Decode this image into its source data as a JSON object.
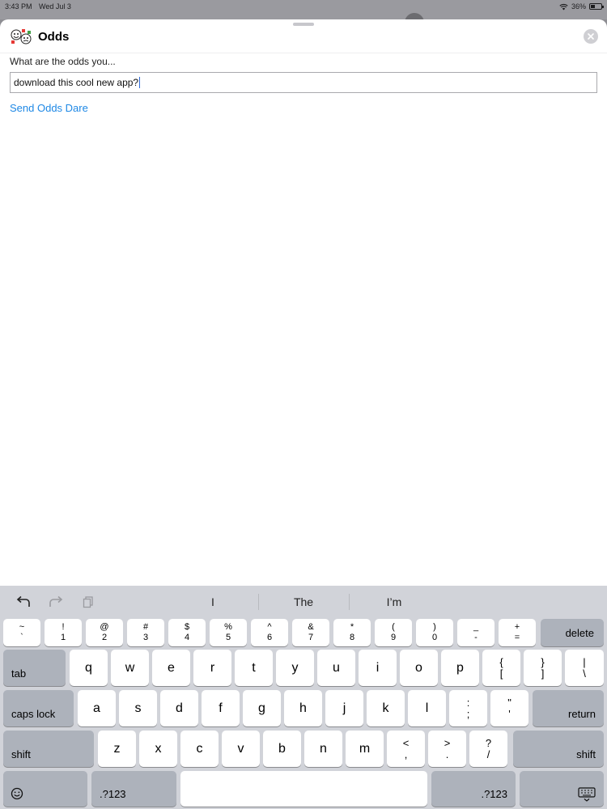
{
  "status": {
    "time": "3:43 PM",
    "date": "Wed Jul 3",
    "battery": "36%"
  },
  "sheet": {
    "title": "Odds",
    "prompt": "What are the odds you...",
    "input_value": "download this cool new app?",
    "send_label": "Send Odds Dare"
  },
  "keyboard": {
    "predictions": [
      "I",
      "The",
      "I’m"
    ],
    "numrow": [
      {
        "top": "~",
        "bottom": "`"
      },
      {
        "top": "!",
        "bottom": "1"
      },
      {
        "top": "@",
        "bottom": "2"
      },
      {
        "top": "#",
        "bottom": "3"
      },
      {
        "top": "$",
        "bottom": "4"
      },
      {
        "top": "%",
        "bottom": "5"
      },
      {
        "top": "^",
        "bottom": "6"
      },
      {
        "top": "&",
        "bottom": "7"
      },
      {
        "top": "*",
        "bottom": "8"
      },
      {
        "top": "(",
        "bottom": "9"
      },
      {
        "top": ")",
        "bottom": "0"
      },
      {
        "top": "_",
        "bottom": "-"
      },
      {
        "top": "+",
        "bottom": "="
      }
    ],
    "delete": "delete",
    "tab": "tab",
    "row1": [
      "q",
      "w",
      "e",
      "r",
      "t",
      "y",
      "u",
      "i",
      "o",
      "p"
    ],
    "row1_extra": [
      {
        "top": "{",
        "bottom": "["
      },
      {
        "top": "}",
        "bottom": "]"
      },
      {
        "top": "|",
        "bottom": "\\"
      }
    ],
    "caps": "caps lock",
    "row2": [
      "a",
      "s",
      "d",
      "f",
      "g",
      "h",
      "j",
      "k",
      "l"
    ],
    "row2_extra": [
      {
        "top": ":",
        "bottom": ";"
      },
      {
        "top": "\"",
        "bottom": "'"
      }
    ],
    "return": "return",
    "shift": "shift",
    "row3": [
      "z",
      "x",
      "c",
      "v",
      "b",
      "n",
      "m"
    ],
    "row3_extra": [
      {
        "top": "<",
        "bottom": ","
      },
      {
        "top": ">",
        "bottom": "."
      },
      {
        "top": "?",
        "bottom": "/"
      }
    ],
    "numbers_key": ".?123"
  },
  "icons": {
    "app": "odds-app-icon",
    "close": "close-icon",
    "undo": "undo-icon",
    "redo": "redo-icon",
    "paste": "paste-icon",
    "emoji": "emoji-icon",
    "dismiss": "keyboard-dismiss-icon"
  },
  "colors": {
    "link": "#1e88e5",
    "caret": "#2f6bd9",
    "keyboard_bg": "#d1d3d9"
  }
}
